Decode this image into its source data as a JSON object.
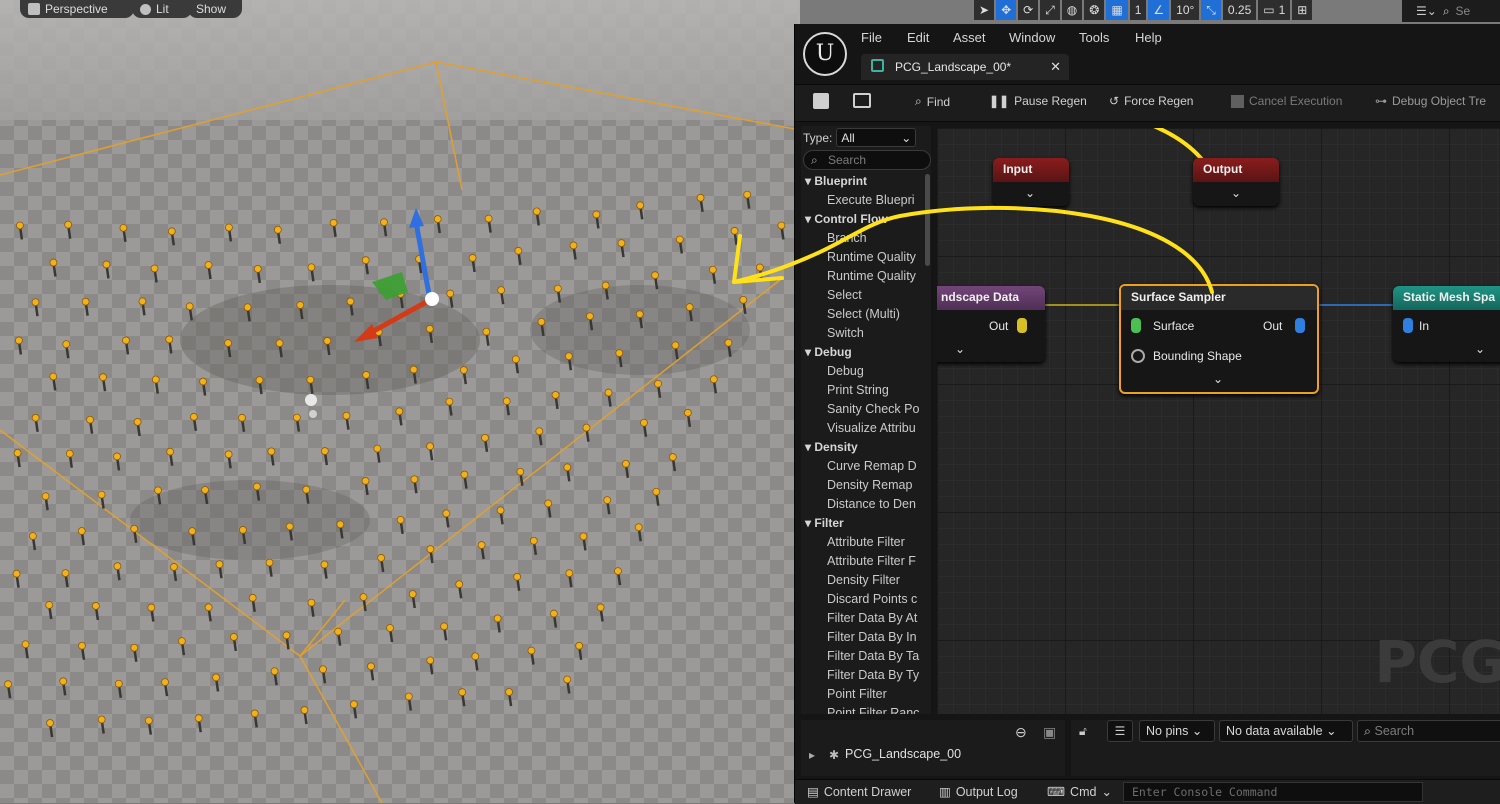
{
  "viewport": {
    "perspective_label": "Perspective",
    "lit_label": "Lit",
    "show_label": "Show",
    "grid_snap_value": "1",
    "rotation_snap_value": "10°",
    "scale_snap_value": "0.25",
    "camera_speed_value": "1",
    "search_placeholder": "Se"
  },
  "editor": {
    "menu": [
      "File",
      "Edit",
      "Asset",
      "Window",
      "Tools",
      "Help"
    ],
    "tab_title": "PCG_Landscape_00*",
    "toolbar": {
      "find": "Find",
      "pause_regen": "Pause Regen",
      "force_regen": "Force Regen",
      "cancel_execution": "Cancel Execution",
      "debug_object_tree": "Debug Object Tre"
    },
    "palette": {
      "type_label": "Type:",
      "type_value": "All",
      "search_placeholder": "Search",
      "categories": [
        {
          "name": "Blueprint",
          "items": [
            "Execute Bluepri"
          ]
        },
        {
          "name": "Control Flow",
          "items": [
            "Branch",
            "Runtime Quality",
            "Runtime Quality",
            "Select",
            "Select (Multi)",
            "Switch"
          ]
        },
        {
          "name": "Debug",
          "items": [
            "Debug",
            "Print String",
            "Sanity Check Po",
            "Visualize Attribu"
          ]
        },
        {
          "name": "Density",
          "items": [
            "Curve Remap D",
            "Density Remap",
            "Distance to Den"
          ]
        },
        {
          "name": "Filter",
          "items": [
            "Attribute Filter",
            "Attribute Filter F",
            "Density Filter",
            "Discard Points c",
            "Filter Data By At",
            "Filter Data By In",
            "Filter Data By Ta",
            "Filter Data By Ty",
            "Point Filter",
            "Point Filter Ranc"
          ]
        }
      ]
    },
    "graph": {
      "input_node": "Input",
      "output_node": "Output",
      "landscape_node": "ndscape Data",
      "landscape_out": "Out",
      "surface_node": "Surface Sampler",
      "surface_pin": "Surface",
      "surface_out": "Out",
      "bounding_pin": "Bounding Shape",
      "static_mesh_node": "Static Mesh Spa",
      "static_mesh_in": "In",
      "watermark": "PCG"
    },
    "details": {
      "tree_item": "PCG_Landscape_00",
      "pins_dropdown": "No pins",
      "data_dropdown": "No data available",
      "search_placeholder": "Search"
    },
    "statusbar": {
      "content_drawer": "Content Drawer",
      "output_log": "Output Log",
      "cmd": "Cmd",
      "console_placeholder": "Enter Console Command"
    }
  },
  "colors": {
    "accent_blue": "#1f6fd6",
    "selection_orange": "#f0a020",
    "annotation_yellow": "#ffe11a",
    "input_header": "#7a1c1c",
    "landscape_header": "#6b3d6e",
    "static_mesh_header": "#1b8a7a"
  }
}
